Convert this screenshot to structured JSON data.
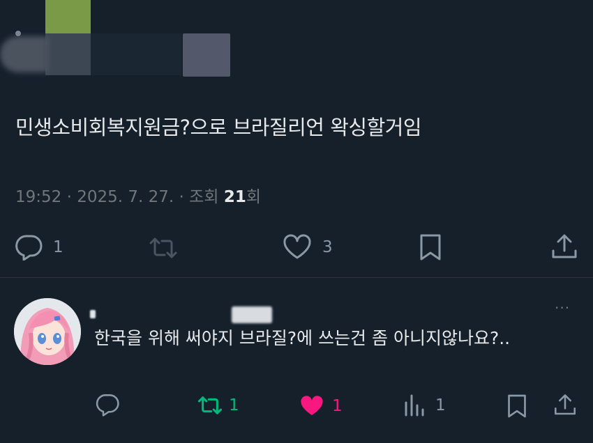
{
  "post": {
    "text": "민생소비회복지원금?으로 브라질리언 왁싱할거임",
    "time": "19:52",
    "date": "2025. 7. 27.",
    "views_label": "조회",
    "views_count": "21",
    "views_suffix": "회",
    "separator": "·",
    "stats": {
      "replies": "1",
      "retweets": "",
      "likes": "3"
    }
  },
  "reply": {
    "text": "한국을 위해 써야지 브라질?에 쓰는건 좀 아니지않나요?..",
    "more": "···",
    "stats": {
      "replies": "",
      "retweets": "1",
      "likes": "1",
      "views": "1"
    },
    "retweeted": true,
    "liked": true
  },
  "colors": {
    "background": "#15202b",
    "text": "#e7e9ea",
    "muted": "#71767b",
    "retweet_active": "#00ba7c",
    "like_active": "#f91880"
  },
  "icons": {
    "reply": "reply-icon",
    "retweet": "retweet-icon",
    "like": "heart-icon",
    "bookmark": "bookmark-icon",
    "share": "share-icon",
    "views": "views-icon",
    "more": "more-icon"
  }
}
